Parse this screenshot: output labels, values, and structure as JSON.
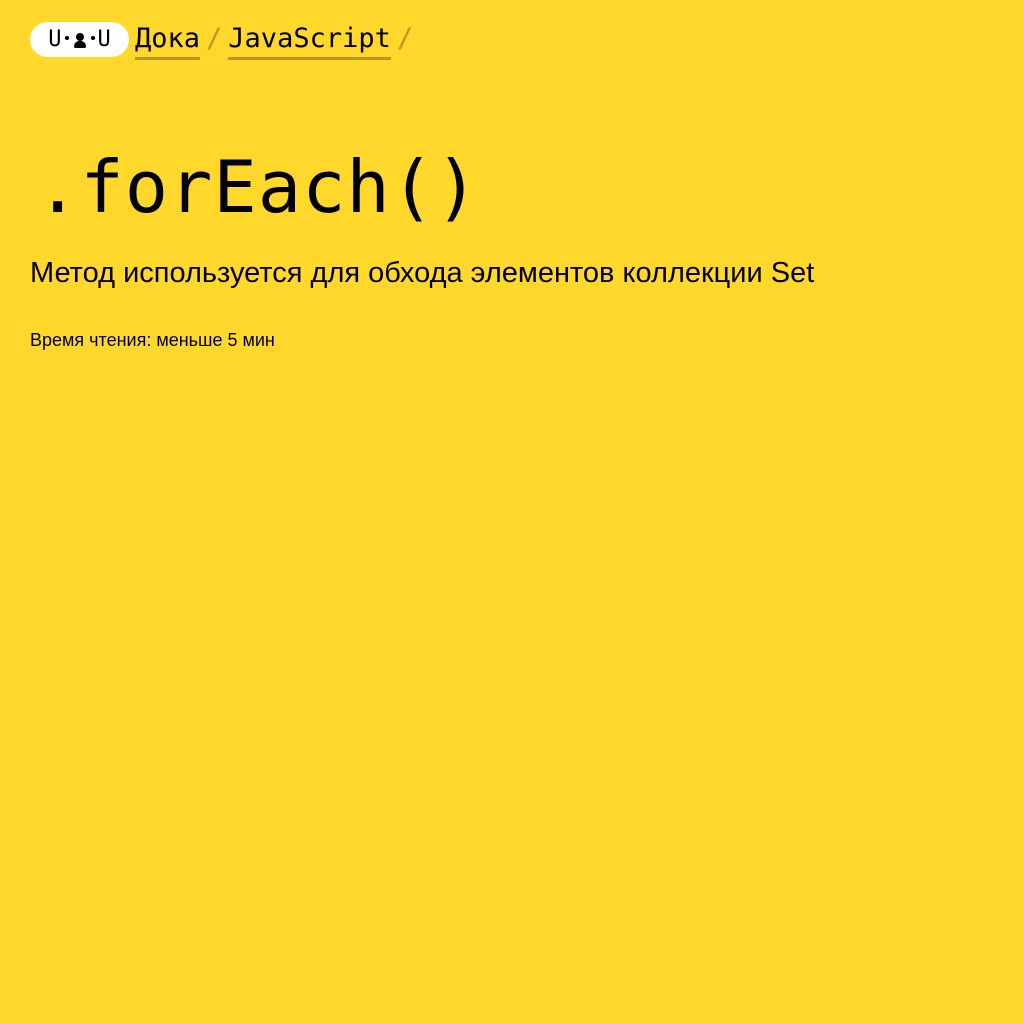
{
  "header": {
    "logo": {
      "icon": "doka-logo-face-icon",
      "left_glyph": "U",
      "right_glyph": "U"
    },
    "breadcrumbs": [
      {
        "label": "Дока"
      },
      {
        "label": "JavaScript"
      }
    ],
    "separator": "/"
  },
  "article": {
    "title": ".forEach()",
    "subtitle": "Метод используется для обхода элементов коллекции Set",
    "reading_time": "Время чтения: меньше 5 мин"
  },
  "colors": {
    "background": "#ffd82b",
    "text": "#000000",
    "logo_background": "#ffffff",
    "underline_and_separator": "#b59a22"
  }
}
